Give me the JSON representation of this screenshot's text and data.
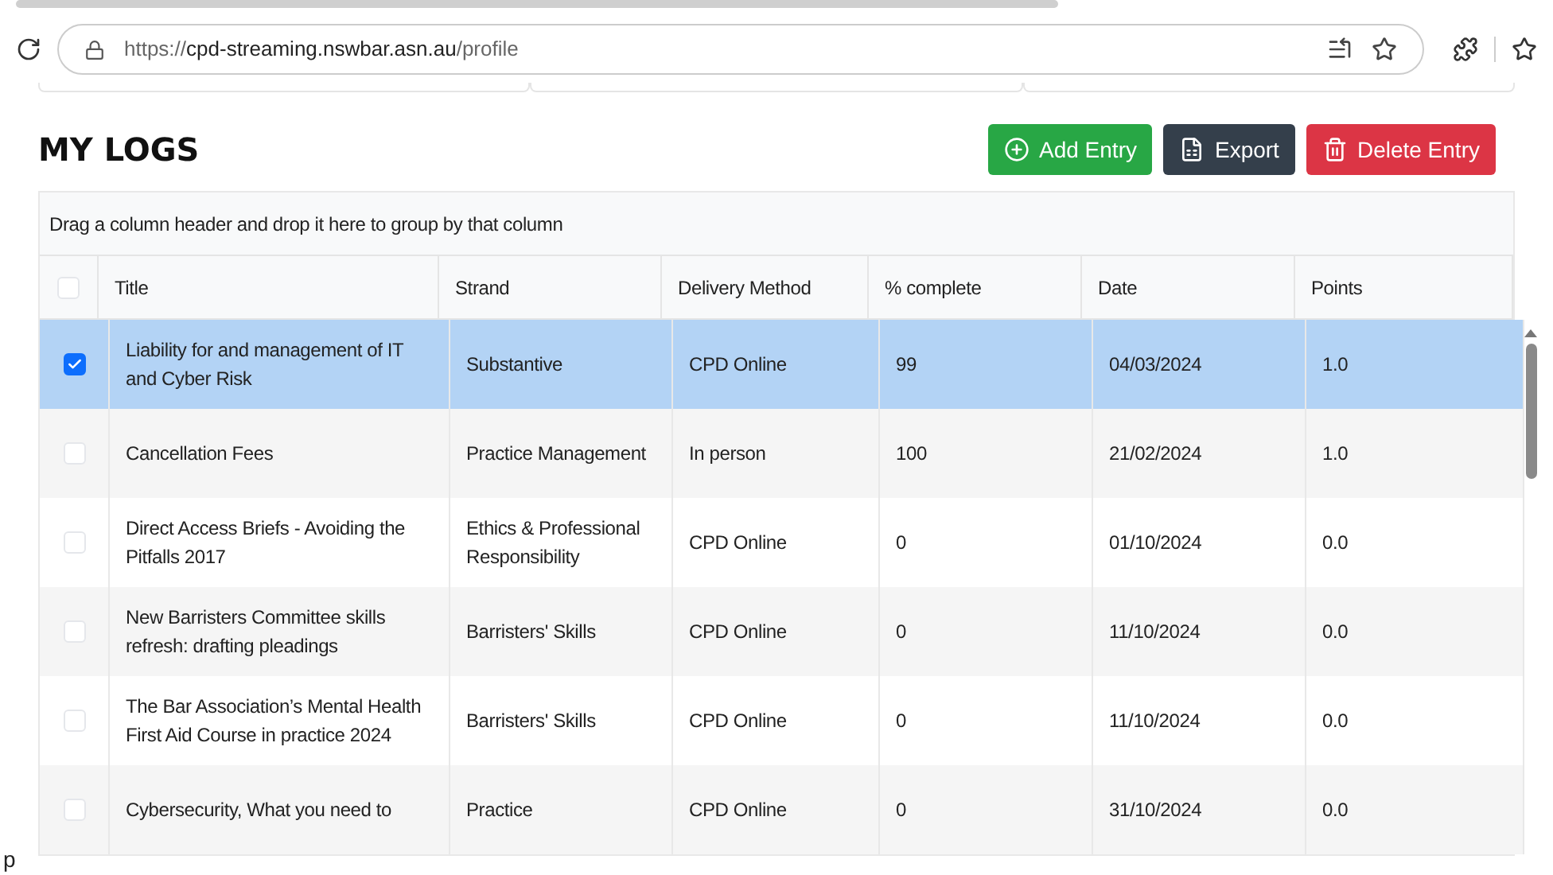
{
  "browser": {
    "url_scheme": "https://",
    "url_host": "cpd-streaming.nswbar.asn.au",
    "url_path": "/profile"
  },
  "page": {
    "title": "MY LOGS",
    "side_fragment": "p"
  },
  "actions": [
    {
      "label": "Add Entry",
      "kind": "add"
    },
    {
      "label": "Export",
      "kind": "export"
    },
    {
      "label": "Delete Entry",
      "kind": "delete"
    }
  ],
  "grid": {
    "group_hint": "Drag a column header and drop it here to group by that column",
    "select_all_checked": false,
    "columns": [
      "Title",
      "Strand",
      "Delivery Method",
      "% complete",
      "Date",
      "Points"
    ],
    "rows": [
      {
        "selected": true,
        "checked": true,
        "cells": [
          "Liability for and management of IT and Cyber Risk",
          "Substantive",
          "CPD Online",
          "99",
          "04/03/2024",
          "1.0"
        ]
      },
      {
        "selected": false,
        "checked": false,
        "cells": [
          "Cancellation Fees",
          "Practice Management",
          "In person",
          "100",
          "21/02/2024",
          "1.0"
        ]
      },
      {
        "selected": false,
        "checked": false,
        "cells": [
          "Direct Access Briefs - Avoiding the Pitfalls 2017",
          "Ethics & Professional Responsibility",
          "CPD Online",
          "0",
          "01/10/2024",
          "0.0"
        ]
      },
      {
        "selected": false,
        "checked": false,
        "cells": [
          "New Barristers Committee skills refresh: drafting pleadings",
          "Barristers' Skills",
          "CPD Online",
          "0",
          "11/10/2024",
          "0.0"
        ]
      },
      {
        "selected": false,
        "checked": false,
        "cells": [
          "The Bar Association’s Mental Health First Aid Course in practice 2024",
          "Barristers' Skills",
          "CPD Online",
          "0",
          "11/10/2024",
          "0.0"
        ]
      },
      {
        "selected": false,
        "checked": false,
        "cells": [
          "Cybersecurity, What you need to",
          "Practice",
          "CPD Online",
          "0",
          "31/10/2024",
          "0.0"
        ]
      }
    ]
  }
}
